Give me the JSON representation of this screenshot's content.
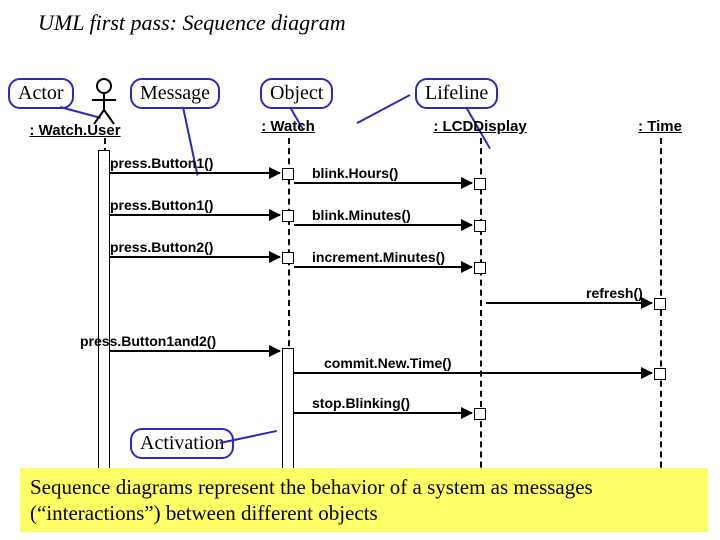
{
  "title": "UML first pass: Sequence diagram",
  "legend": {
    "actor": "Actor",
    "message": "Message",
    "object": "Object",
    "lifeline": "Lifeline",
    "activation": "Activation"
  },
  "lifelines": {
    "watchuser": ": Watch.User",
    "watch": ": Watch",
    "lcddisplay": ": LCDDisplay",
    "time": ": Time"
  },
  "messages": {
    "b1a": "press.Button1()",
    "b1b": "press.Button1()",
    "b2": "press.Button2()",
    "b12": "press.Button1and2()",
    "blinkH": "blink.Hours()",
    "blinkM": "blink.Minutes()",
    "incM": "increment.Minutes()",
    "refresh": "refresh()",
    "commit": "commit.New.Time()",
    "stopB": "stop.Blinking()"
  },
  "caption": "Sequence diagrams represent the behavior of a system as messages (“interactions”) between different objects",
  "chart_data": {
    "type": "sequence-diagram",
    "actors": [
      {
        "name": ": Watch.User",
        "kind": "actor"
      },
      {
        "name": ": Watch",
        "kind": "object"
      },
      {
        "name": ": LCDDisplay",
        "kind": "object"
      },
      {
        "name": ": Time",
        "kind": "object"
      }
    ],
    "messages": [
      {
        "from": ": Watch.User",
        "to": ": Watch",
        "label": "press.Button1()"
      },
      {
        "from": ": Watch",
        "to": ": LCDDisplay",
        "label": "blink.Hours()"
      },
      {
        "from": ": Watch.User",
        "to": ": Watch",
        "label": "press.Button1()"
      },
      {
        "from": ": Watch",
        "to": ": LCDDisplay",
        "label": "blink.Minutes()"
      },
      {
        "from": ": Watch.User",
        "to": ": Watch",
        "label": "press.Button2()"
      },
      {
        "from": ": Watch",
        "to": ": LCDDisplay",
        "label": "increment.Minutes()"
      },
      {
        "from": ": LCDDisplay",
        "to": ": Time",
        "label": "refresh()"
      },
      {
        "from": ": Watch.User",
        "to": ": Watch",
        "label": "press.Button1and2()"
      },
      {
        "from": ": Watch",
        "to": ": Time",
        "label": "commit.New.Time()"
      },
      {
        "from": ": Watch",
        "to": ": LCDDisplay",
        "label": "stop.Blinking()"
      }
    ],
    "legend_callouts": [
      "Actor",
      "Message",
      "Object",
      "Lifeline",
      "Activation"
    ]
  }
}
